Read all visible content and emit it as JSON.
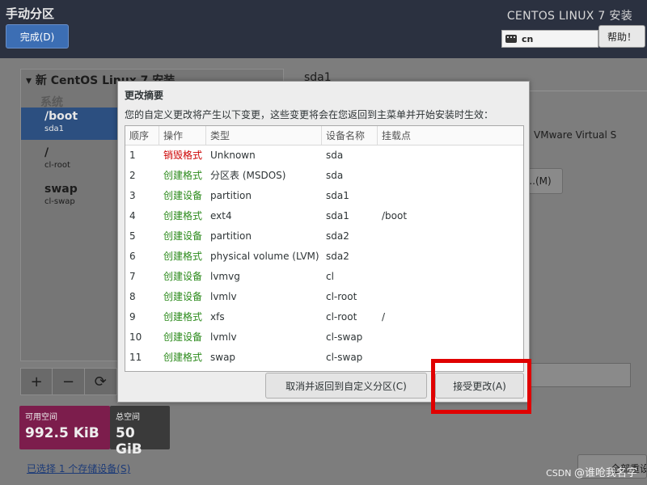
{
  "header": {
    "title": "手动分区",
    "done_label": "完成(D)",
    "product": "CENTOS LINUX 7 安装",
    "keyboard_layout": "cn",
    "help_label": "帮助！"
  },
  "left_panel": {
    "install_title": "新 CentOS Linux 7 安装",
    "system_label": "系统",
    "mount_points": [
      {
        "name": "/boot",
        "device": "sda1"
      },
      {
        "name": "/",
        "device": "cl-root"
      },
      {
        "name": "swap",
        "device": "cl-swap"
      }
    ],
    "tools": {
      "add": "+",
      "remove": "−",
      "refresh": "⟳"
    }
  },
  "space": {
    "available_label": "可用空间",
    "available_value": "992.5 KiB",
    "total_label": "总空间",
    "total_value": "50 GiB"
  },
  "storage_link": "已选择 1 个存储设备(S)",
  "right": {
    "device_title": "sda1",
    "device_text": "VMware Virtual S",
    "modify_label": "..(M)",
    "reset_label": "全部重设(R)"
  },
  "dialog": {
    "title": "更改摘要",
    "description": "您的自定义更改将产生以下变更，这些变更将会在您返回到主菜单并开始安装时生效：",
    "columns": [
      "顺序",
      "操作",
      "类型",
      "设备名称",
      "挂载点"
    ],
    "rows": [
      {
        "order": "1",
        "action": "销毁格式",
        "type": "Unknown",
        "device": "sda",
        "mount": ""
      },
      {
        "order": "2",
        "action": "创建格式",
        "type": "分区表 (MSDOS)",
        "device": "sda",
        "mount": ""
      },
      {
        "order": "3",
        "action": "创建设备",
        "type": "partition",
        "device": "sda1",
        "mount": ""
      },
      {
        "order": "4",
        "action": "创建格式",
        "type": "ext4",
        "device": "sda1",
        "mount": "/boot"
      },
      {
        "order": "5",
        "action": "创建设备",
        "type": "partition",
        "device": "sda2",
        "mount": ""
      },
      {
        "order": "6",
        "action": "创建格式",
        "type": "physical volume (LVM)",
        "device": "sda2",
        "mount": ""
      },
      {
        "order": "7",
        "action": "创建设备",
        "type": "lvmvg",
        "device": "cl",
        "mount": ""
      },
      {
        "order": "8",
        "action": "创建设备",
        "type": "lvmlv",
        "device": "cl-root",
        "mount": ""
      },
      {
        "order": "9",
        "action": "创建格式",
        "type": "xfs",
        "device": "cl-root",
        "mount": "/"
      },
      {
        "order": "10",
        "action": "创建设备",
        "type": "lvmlv",
        "device": "cl-swap",
        "mount": ""
      },
      {
        "order": "11",
        "action": "创建格式",
        "type": "swap",
        "device": "cl-swap",
        "mount": ""
      }
    ],
    "cancel_label": "取消并返回到自定义分区(C)",
    "accept_label": "接受更改(A)"
  },
  "watermark": {
    "prefix": "CSDN ",
    "author": "@谁呛我名字"
  },
  "colors": {
    "header_bg": "#2b3140",
    "selected": "#2c4f80",
    "destroy": "#cc0000",
    "create": "#2b8a1b",
    "highlight": "#e00000"
  }
}
